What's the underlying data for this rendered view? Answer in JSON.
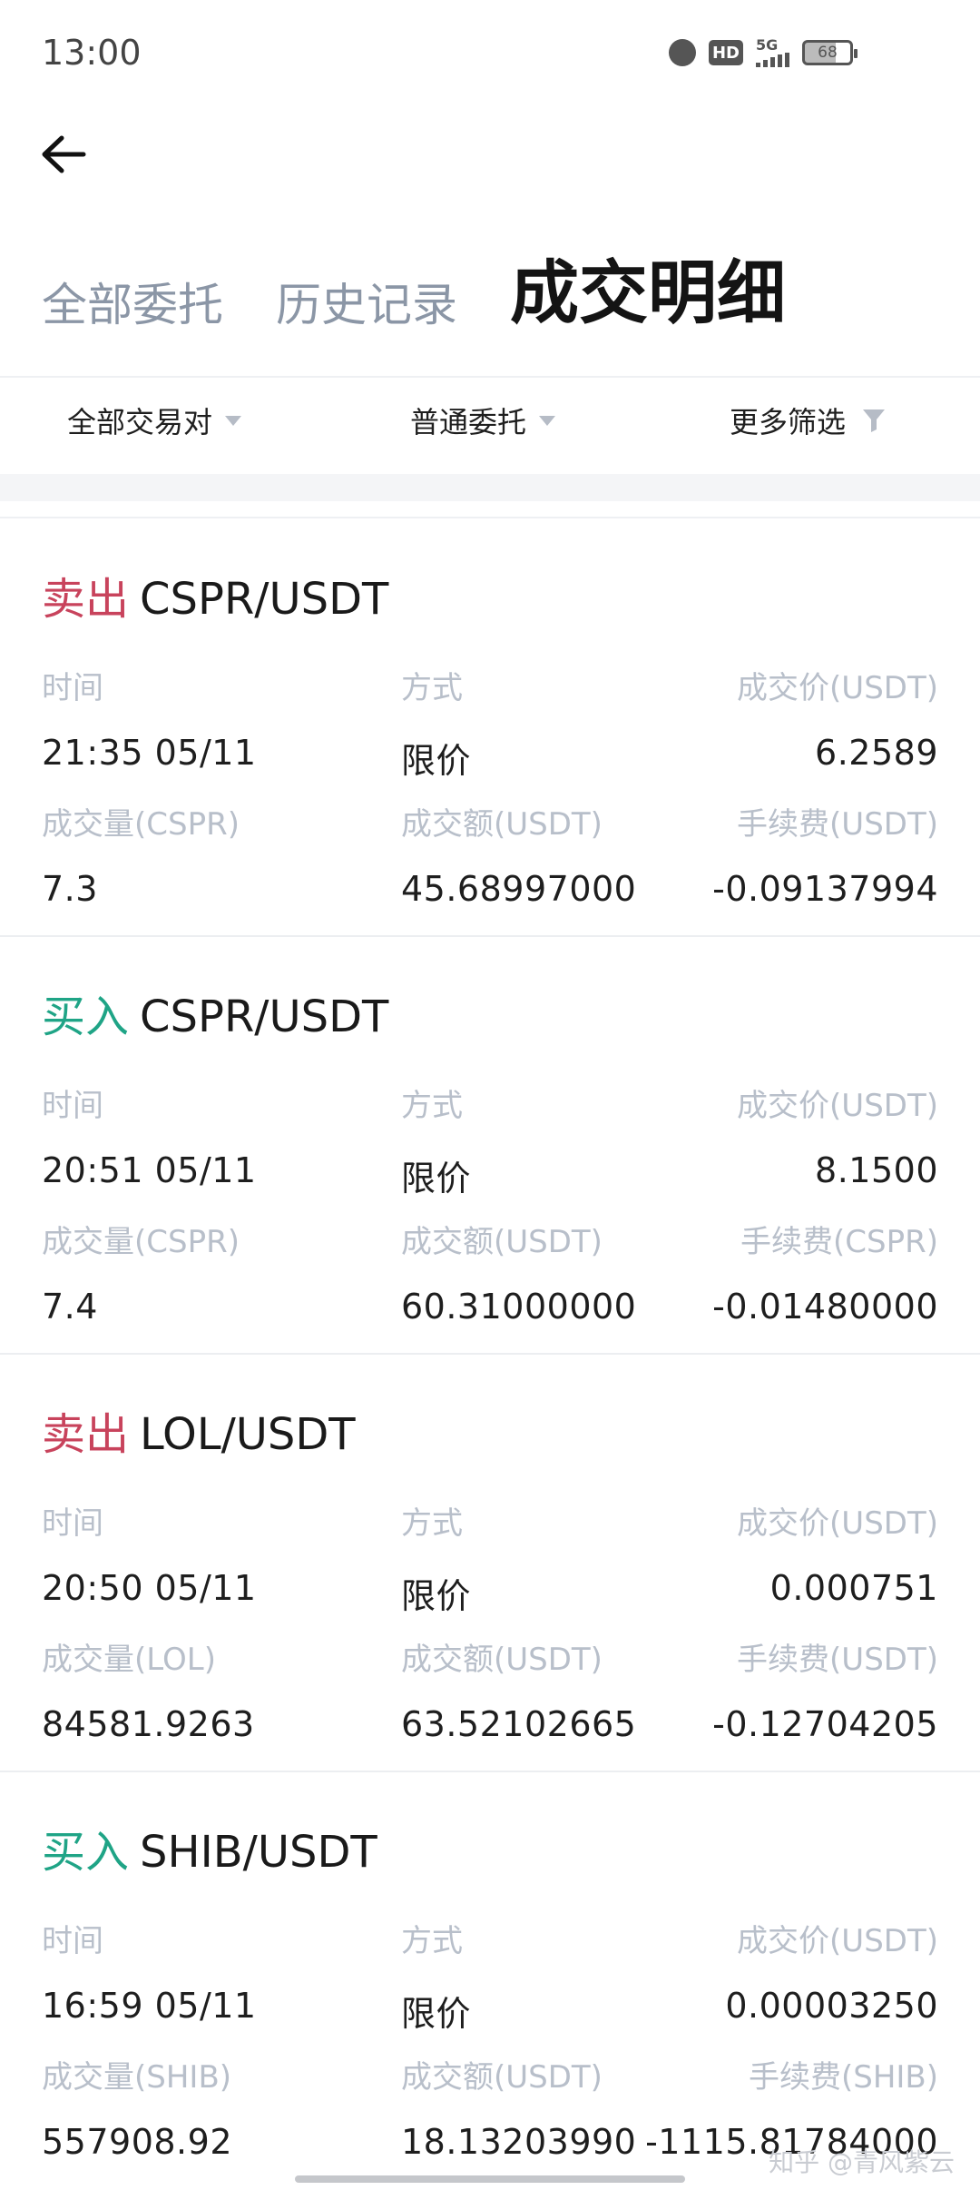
{
  "status_bar": {
    "time": "13:00",
    "network": "5G",
    "battery": "68",
    "hd": "HD"
  },
  "tabs": [
    {
      "label": "全部委托",
      "active": false
    },
    {
      "label": "历史记录",
      "active": false
    },
    {
      "label": "成交明细",
      "active": true
    }
  ],
  "filters": {
    "pair": "全部交易对",
    "order_type": "普通委托",
    "more": "更多筛选"
  },
  "labels": {
    "time": "时间",
    "method": "方式",
    "price": "成交价(USDT)",
    "amount_usdt": "成交额(USDT)"
  },
  "trades": [
    {
      "side": "卖出",
      "side_type": "sell",
      "pair": "CSPR/USDT",
      "time": "21:35 05/11",
      "method": "限价",
      "price": "6.2589",
      "qty_label": "成交量(CSPR)",
      "qty": "7.3",
      "amount_label": "成交额(USDT)",
      "amount": "45.68997000",
      "fee_label": "手续费(USDT)",
      "fee": "-0.09137994"
    },
    {
      "side": "买入",
      "side_type": "buy",
      "pair": "CSPR/USDT",
      "time": "20:51 05/11",
      "method": "限价",
      "price": "8.1500",
      "qty_label": "成交量(CSPR)",
      "qty": "7.4",
      "amount_label": "成交额(USDT)",
      "amount": "60.31000000",
      "fee_label": "手续费(CSPR)",
      "fee": "-0.01480000"
    },
    {
      "side": "卖出",
      "side_type": "sell",
      "pair": "LOL/USDT",
      "time": "20:50 05/11",
      "method": "限价",
      "price": "0.000751",
      "qty_label": "成交量(LOL)",
      "qty": "84581.9263",
      "amount_label": "成交额(USDT)",
      "amount": "63.52102665",
      "fee_label": "手续费(USDT)",
      "fee": "-0.12704205"
    },
    {
      "side": "买入",
      "side_type": "buy",
      "pair": "SHIB/USDT",
      "time": "16:59 05/11",
      "method": "限价",
      "price": "0.00003250",
      "qty_label": "成交量(SHIB)",
      "qty": "557908.92",
      "amount_label": "成交额(USDT)",
      "amount": "18.13203990",
      "fee_label": "手续费(SHIB)",
      "fee": "-1115.81784000"
    }
  ],
  "watermark": "知乎 @青风紫云",
  "colors": {
    "sell": "#c8435c",
    "buy": "#1fa486",
    "label_gray": "#b8bfca"
  }
}
